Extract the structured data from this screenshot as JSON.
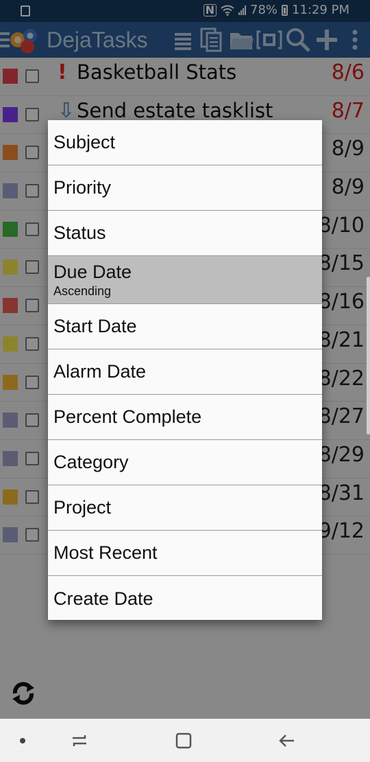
{
  "status_bar": {
    "battery": "78%",
    "time": "11:29 PM"
  },
  "app": {
    "title": "DejaTasks"
  },
  "tasks": [
    {
      "color": "#e2434a",
      "priority": "!",
      "priority_color": "#e0231c",
      "subject": "Basketball Stats",
      "due": "8/6",
      "due_color": "#d21d1d"
    },
    {
      "color": "#7d3cf2",
      "priority": "⇩",
      "priority_color": "#6a8db8",
      "subject": "Send estate tasklist",
      "due": "8/7",
      "due_color": "#d21d1d"
    },
    {
      "color": "#f08535",
      "priority": "",
      "subject": "",
      "due": "8/9",
      "due_color": "#222"
    },
    {
      "color": "#9a9fc6",
      "priority": "",
      "subject": "",
      "due": "8/9",
      "due_color": "#222"
    },
    {
      "color": "#46b545",
      "priority": "",
      "subject": "",
      "due": "8/10",
      "due_color": "#222"
    },
    {
      "color": "#f1e34c",
      "priority": "",
      "subject": "",
      "due": "8/15",
      "due_color": "#222"
    },
    {
      "color": "#e95c55",
      "priority": "",
      "subject": "",
      "due": "8/16",
      "due_color": "#222"
    },
    {
      "color": "#f1e34c",
      "priority": "",
      "subject": "",
      "due": "8/21",
      "due_color": "#222"
    },
    {
      "color": "#f3b632",
      "priority": "",
      "subject": "",
      "due": "8/22",
      "due_color": "#222"
    },
    {
      "color": "#9a9fc6",
      "priority": "",
      "subject": "",
      "due": "8/27",
      "due_color": "#222"
    },
    {
      "color": "#9a9fc6",
      "priority": "",
      "subject": "",
      "due": "8/29",
      "due_color": "#222"
    },
    {
      "color": "#f3b632",
      "priority": "",
      "subject": "",
      "due": "8/31",
      "due_color": "#222"
    },
    {
      "color": "#9a9fc6",
      "priority": "",
      "subject": "",
      "due": "9/12",
      "due_color": "#222"
    }
  ],
  "sort_menu": {
    "items": [
      {
        "label": "Subject"
      },
      {
        "label": "Priority"
      },
      {
        "label": "Status"
      },
      {
        "label": "Due Date",
        "sub": "Ascending",
        "selected": true
      },
      {
        "label": "Start Date"
      },
      {
        "label": "Alarm Date"
      },
      {
        "label": "Percent Complete"
      },
      {
        "label": "Category"
      },
      {
        "label": "Project"
      },
      {
        "label": "Most Recent"
      },
      {
        "label": "Create Date"
      }
    ]
  },
  "icons": {
    "toolbar": [
      "list-icon",
      "copy-icon",
      "folder-icon",
      "expand-icon",
      "search-icon",
      "add-icon",
      "overflow-icon"
    ]
  }
}
